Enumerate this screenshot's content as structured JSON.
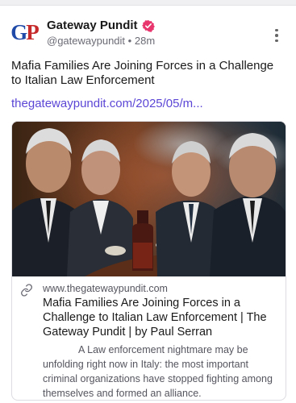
{
  "author": {
    "avatar_text_left": "G",
    "avatar_text_right": "P",
    "display_name": "Gateway Pundit",
    "handle": "@gatewaypundit",
    "separator": "•",
    "time_ago": "28m",
    "verified_color": "#e8356d"
  },
  "post": {
    "text": "Mafia Families Are Joining Forces in a Challenge to Italian Law Enforcement",
    "link_text": "thegatewaypundit.com/2025/05/m...",
    "link_color": "#5b46d6"
  },
  "card": {
    "image_subject": "four older men in suits seated around a table with a wine bottle and coffee cups",
    "domain": "www.thegatewaypundit.com",
    "title": "Mafia Families Are Joining Forces in a Challenge to Italian Law Enforcement | The Gateway Pundit | by Paul Serran",
    "description": "A Law enforcement nightmare may be unfolding right now in Italy: the most important criminal organizations have stopped fighting among themselves and formed an alliance."
  },
  "icons": {
    "verified": "verified-badge-icon",
    "more": "more-vertical-icon",
    "link": "link-icon"
  }
}
